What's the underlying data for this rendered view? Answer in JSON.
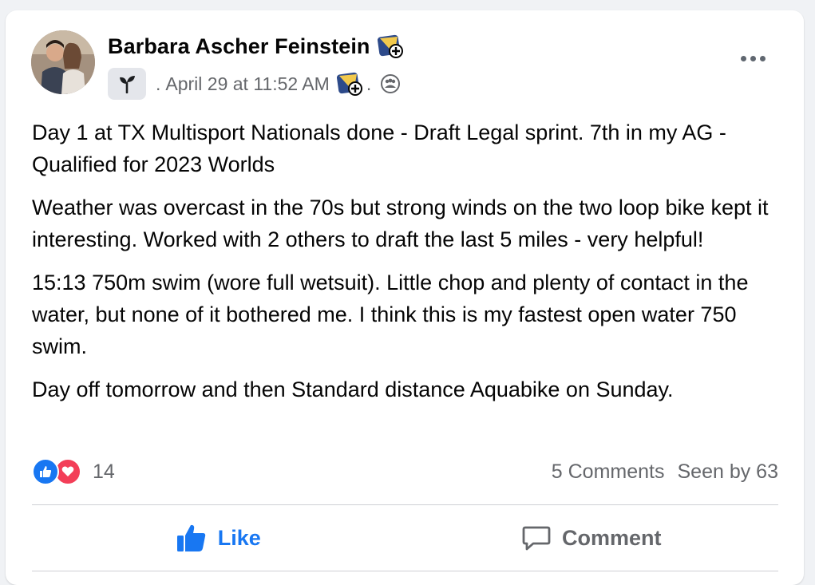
{
  "post": {
    "author": "Barbara Ascher Feinstein",
    "timestamp": "April 29 at 11:52 AM",
    "meta_prefix": ".",
    "meta_suffix": ".",
    "body": [
      "Day 1 at TX Multisport Nationals done - Draft Legal sprint. 7th in my AG - Qualified for 2023 Worlds",
      "Weather was overcast in the 70s but strong winds on the two loop bike kept it interesting. Worked with 2 others to draft the last 5 miles - very helpful!",
      "15:13 750m swim (wore full wetsuit). Little chop and plenty of contact in the water, but none of it bothered me. I think this is my fastest open water 750 swim.",
      "Day off tomorrow and then Standard distance Aquabike on Sunday."
    ]
  },
  "stats": {
    "reaction_count": "14",
    "comments": "5 Comments",
    "seen_by": "Seen by 63"
  },
  "actions": {
    "like_label": "Like",
    "comment_label": "Comment"
  },
  "icons": {
    "badge": "new-member-badge-icon",
    "group": "sprout-icon",
    "audience": "group-audience-icon",
    "like": "thumbs-up-icon",
    "love": "heart-icon",
    "comment": "speech-bubble-icon",
    "more": "more-options-icon"
  },
  "colors": {
    "accent": "#1877f2",
    "love": "#f33e58",
    "muted_text": "#65676b",
    "badge_yellow": "#f2c94c"
  }
}
